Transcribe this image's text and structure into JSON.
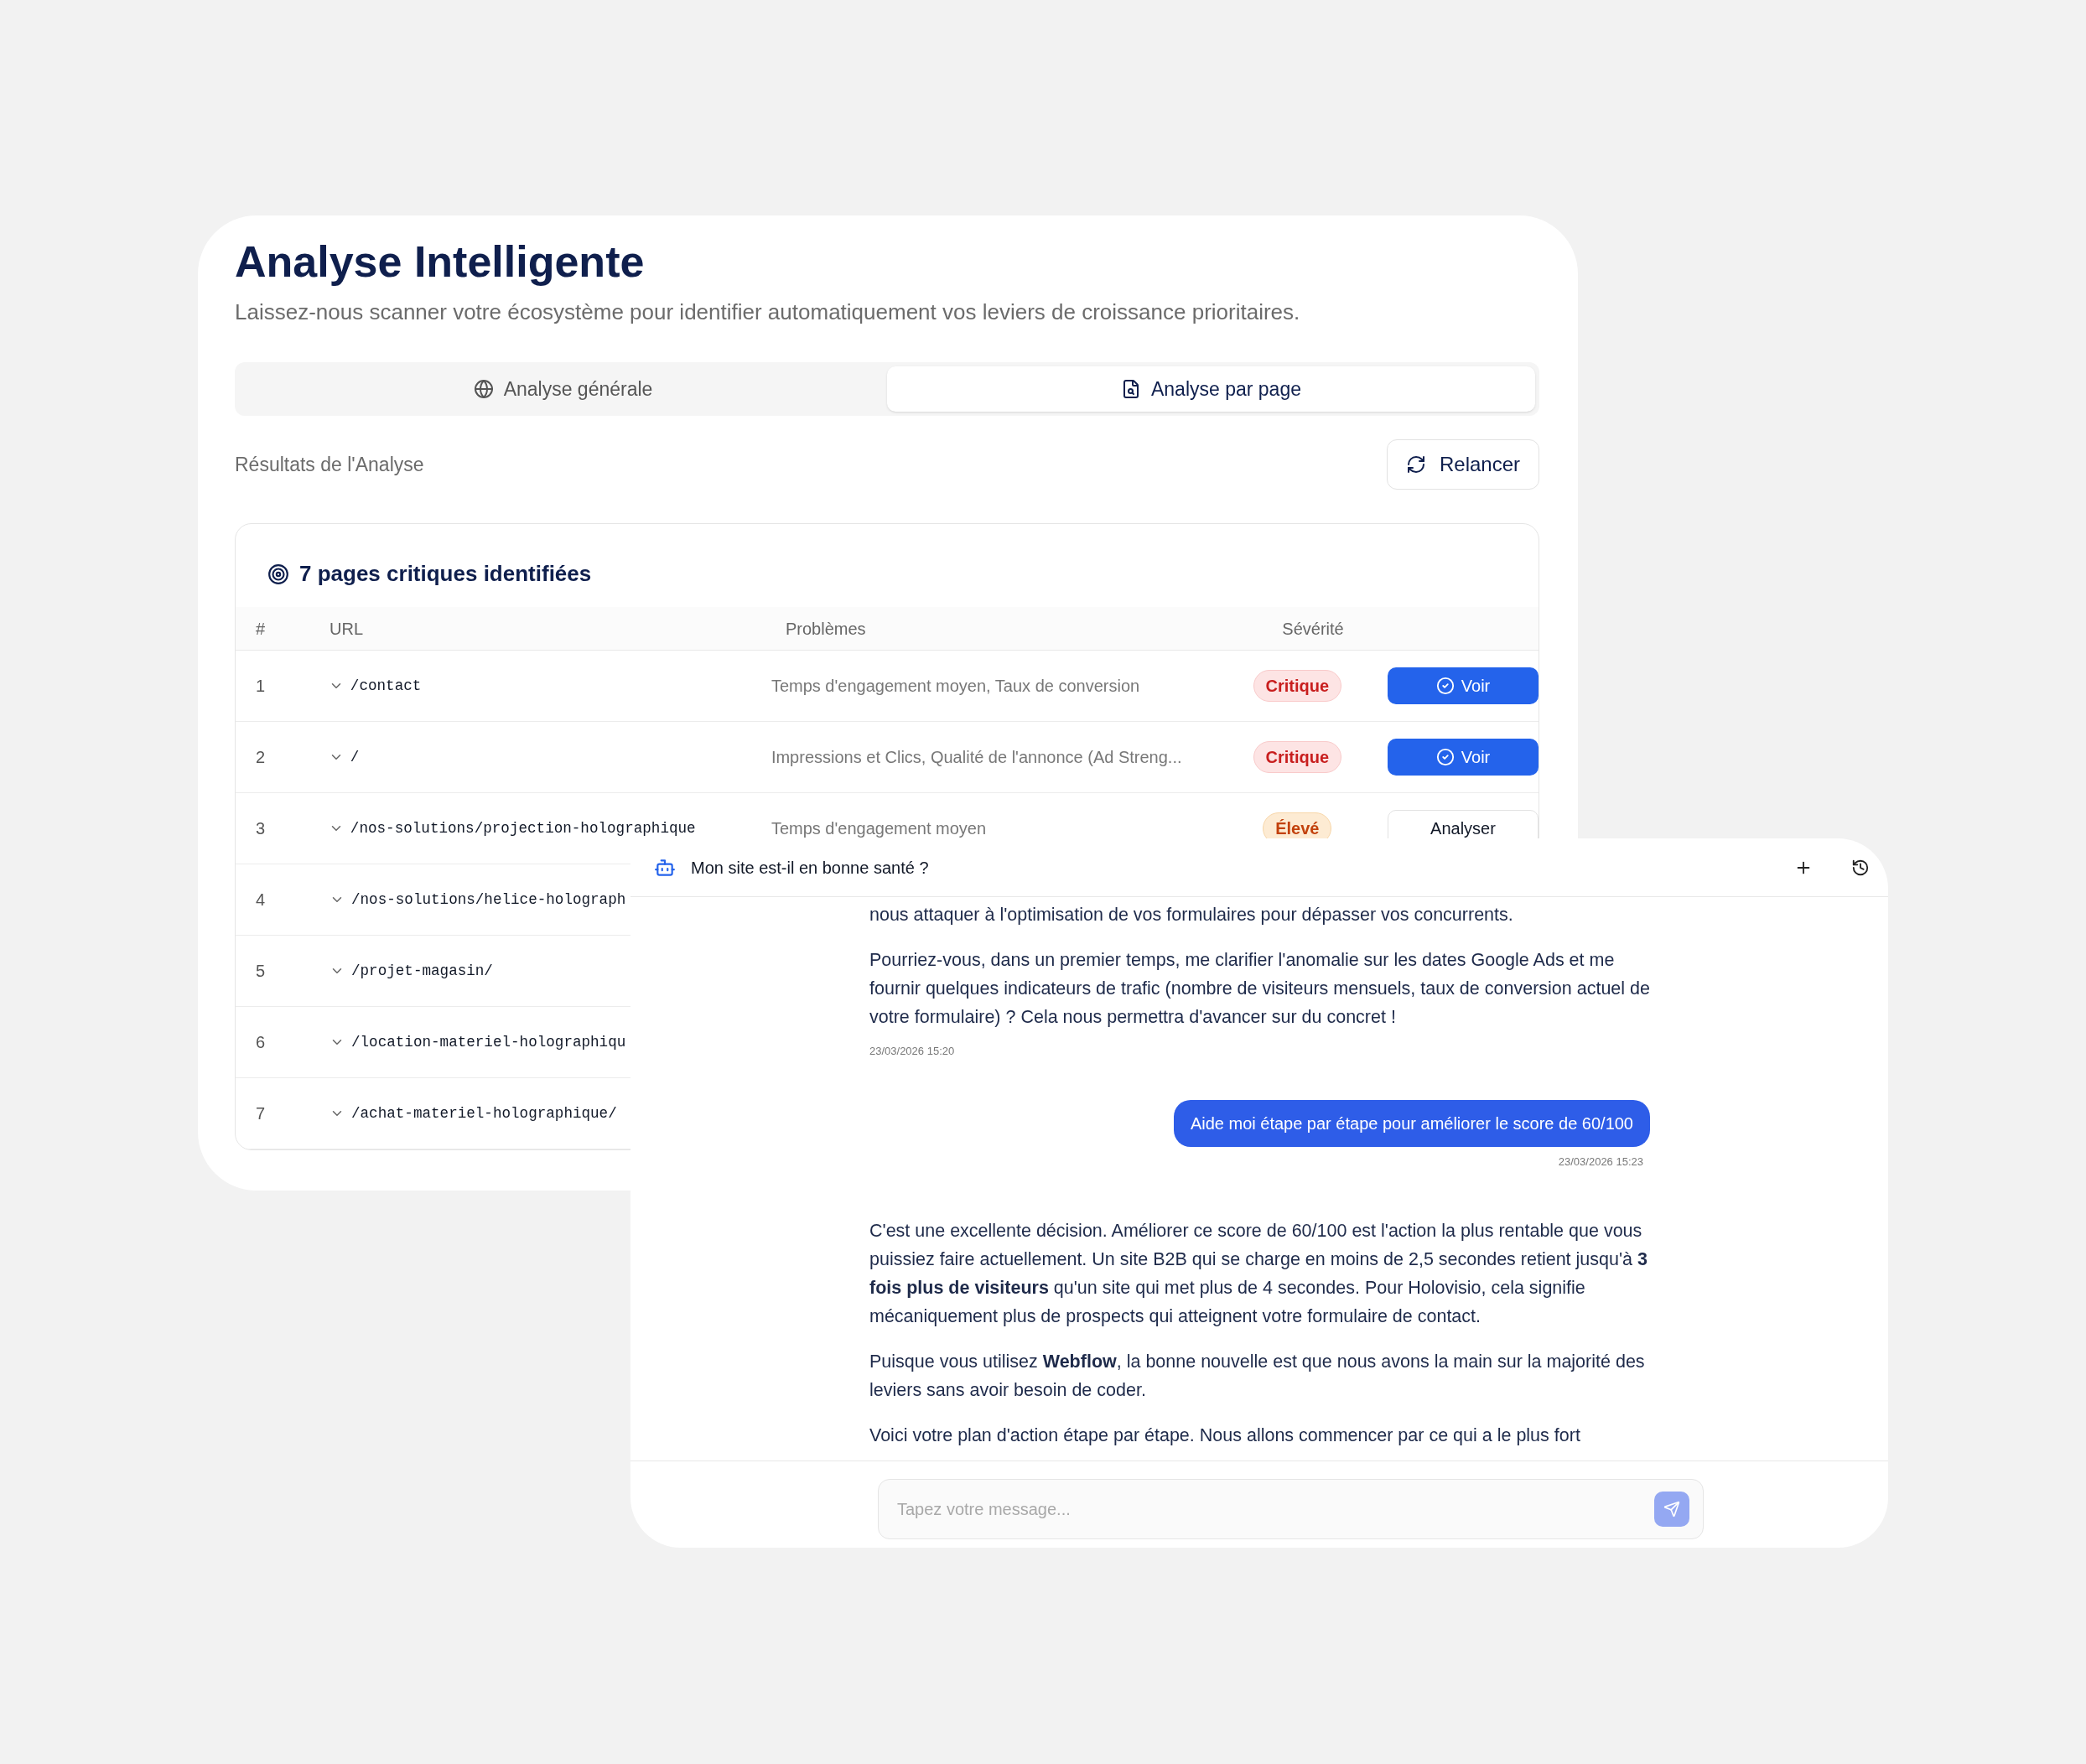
{
  "analysis_panel": {
    "title": "Analyse Intelligente",
    "subtitle": "Laissez-nous scanner votre écosystème pour identifier automatiquement vos leviers de croissance prioritaires.",
    "tabs": [
      {
        "label": "Analyse générale",
        "selected": false
      },
      {
        "label": "Analyse par page",
        "selected": true
      }
    ],
    "results_label": "Résultats de l'Analyse",
    "rerun_button": "Relancer",
    "card": {
      "heading": "7 pages critiques identifiées",
      "columns": [
        "#",
        "URL",
        "Problèmes",
        "Sévérité"
      ],
      "rows": [
        {
          "number": "1",
          "url": "/contact",
          "problems": "Temps d'engagement moyen, Taux de conversion",
          "severity": {
            "label": "Critique",
            "kind": "critical"
          },
          "action": {
            "label": "Voir",
            "kind": "view"
          }
        },
        {
          "number": "2",
          "url": "/",
          "problems": "Impressions et Clics, Qualité de l'annonce (Ad Streng...",
          "severity": {
            "label": "Critique",
            "kind": "critical"
          },
          "action": {
            "label": "Voir",
            "kind": "view"
          }
        },
        {
          "number": "3",
          "url": "/nos-solutions/projection-holographique",
          "problems": "Temps d'engagement moyen",
          "severity": {
            "label": "Élevé",
            "kind": "high"
          },
          "action": {
            "label": "Analyser",
            "kind": "analyze"
          }
        },
        {
          "number": "4",
          "url": "/nos-solutions/helice-holograph"
        },
        {
          "number": "5",
          "url": "/projet-magasin/"
        },
        {
          "number": "6",
          "url": "/location-materiel-holographiqu"
        },
        {
          "number": "7",
          "url": "/achat-materiel-holographique/"
        }
      ]
    }
  },
  "chat": {
    "title": "Mon site est-il en bonne santé ?",
    "messages": [
      {
        "kind": "assistant",
        "paragraphs": [
          "nous attaquer à l'optimisation de vos formulaires pour dépasser vos concurrents.",
          "Pourriez-vous, dans un premier temps, me clarifier l'anomalie sur les dates Google Ads et me fournir quelques indicateurs de trafic (nombre de visiteurs mensuels, taux de conversion actuel de votre formulaire) ? Cela nous permettra d'avancer sur du concret !"
        ],
        "time": "23/03/2026 15:20"
      },
      {
        "kind": "user",
        "paragraphs": [
          "Aide moi étape par étape pour améliorer le score de 60/100"
        ],
        "time": "23/03/2026 15:23"
      },
      {
        "kind": "assistant",
        "paragraphs": [
          "C'est une excellente décision. Améliorer ce score de 60/100 est l'action la plus rentable que vous puissiez faire actuellement. Un site B2B qui se charge en moins de 2,5 secondes retient jusqu'à **3 fois plus de visiteurs** qu'un site qui met plus de 4 secondes. Pour Holovisio, cela signifie mécaniquement plus de prospects qui atteignent votre formulaire de contact.",
          "Puisque vous utilisez **Webflow**, la bonne nouvelle est que nous avons la main sur la majorité des leviers sans avoir besoin de coder.",
          "Voici votre plan d'action étape par étape. Nous allons commencer par ce qui a le plus fort"
        ]
      }
    ],
    "input": {
      "placeholder": "Tapez votre message..."
    }
  }
}
